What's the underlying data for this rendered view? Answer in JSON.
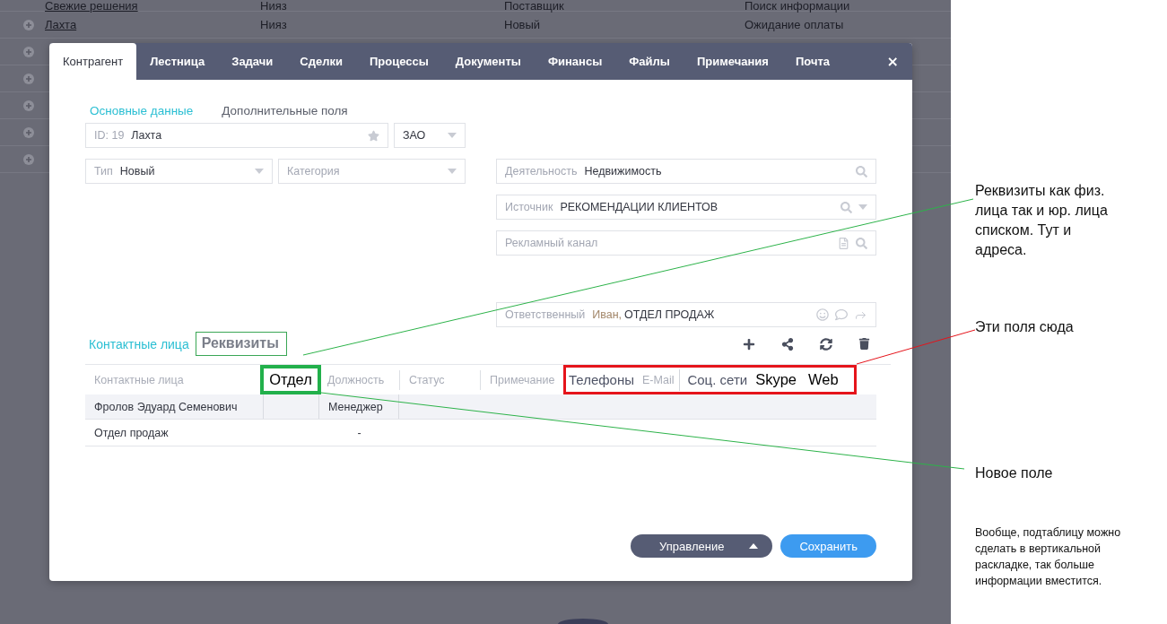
{
  "background_table": {
    "rows": [
      {
        "kind": "visible",
        "cells": [
          "Свежие решения",
          "Нияз",
          "Поставщик",
          "Поиск информации"
        ]
      },
      {
        "kind": "visible",
        "cells": [
          "Лахта",
          "Нияз",
          "Новый",
          "Ожидание оплаты"
        ]
      },
      {
        "kind": "covered"
      },
      {
        "kind": "covered"
      },
      {
        "kind": "covered"
      },
      {
        "kind": "covered"
      },
      {
        "kind": "covered"
      }
    ]
  },
  "dialog": {
    "tabs": [
      {
        "label": "Контрагент",
        "selected": true
      },
      {
        "label": "Лестница",
        "selected": false
      },
      {
        "label": "Задачи",
        "selected": false
      },
      {
        "label": "Сделки",
        "selected": false
      },
      {
        "label": "Процессы",
        "selected": false
      },
      {
        "label": "Документы",
        "selected": false
      },
      {
        "label": "Финансы",
        "selected": false
      },
      {
        "label": "Файлы",
        "selected": false
      },
      {
        "label": "Примечания",
        "selected": false
      },
      {
        "label": "Почта",
        "selected": false
      }
    ],
    "close": "×",
    "subtabs": [
      {
        "label": "Основные данные",
        "selected": true
      },
      {
        "label": "Дополнительные поля",
        "selected": false
      }
    ],
    "left_rows": [
      [
        {
          "kind": "name",
          "label": "ID: 19",
          "value": "Лахта"
        },
        {
          "kind": "select",
          "value": "ЗАО"
        }
      ],
      [
        {
          "kind": "select",
          "label": "Тип",
          "value": "Новый"
        },
        {
          "kind": "select",
          "placeholder": "Категория"
        }
      ]
    ],
    "right_fields": [
      {
        "kind": "search",
        "label": "Деятельность",
        "value": "Недвижимость"
      },
      {
        "kind": "search_select",
        "label": "Источник",
        "value": "РЕКОМЕНДАЦИИ КЛИЕНТОВ"
      },
      {
        "kind": "list_search",
        "placeholder": "Рекламный канал"
      }
    ],
    "responsible": {
      "label": "Ответственный",
      "person": "Иван,",
      "department": "ОТДЕЛ ПРОДАЖ"
    },
    "section_tabs": [
      {
        "label": "Контактные лица",
        "selected": true,
        "marked": false
      },
      {
        "label": "Реквизиты",
        "selected": false,
        "marked": true
      }
    ],
    "contacts_table": {
      "columns": [
        {
          "label": "Контактные лица",
          "kind": "existing",
          "marked": false
        },
        {
          "label": "Отдел",
          "kind": "added",
          "marked": true
        },
        {
          "label": "Должность",
          "kind": "existing",
          "marked": false
        },
        {
          "label": "Статус",
          "kind": "existing",
          "marked": false
        },
        {
          "label": "Примечание",
          "kind": "existing",
          "marked": false
        }
      ],
      "proposed_groups": [
        {
          "columns": [
            {
              "label": "Телефоны",
              "kind": "moved"
            },
            {
              "label": "E-Mail",
              "kind": "existing"
            }
          ]
        },
        {
          "columns": [
            {
              "label": "Соц. сети",
              "kind": "moved"
            },
            {
              "label": "Skype",
              "kind": "added"
            },
            {
              "label": "Web",
              "kind": "added"
            }
          ]
        }
      ],
      "rows": [
        {
          "kind": "contact",
          "selected": true,
          "name": "Фролов Эдуард Семенович",
          "position": "Менеджер"
        },
        {
          "kind": "department",
          "selected": false,
          "name": "Отдел продаж",
          "position": "-"
        }
      ]
    },
    "buttons": [
      {
        "kind": "menu",
        "label": "Управление"
      },
      {
        "kind": "primary",
        "label": "Сохранить"
      }
    ]
  },
  "notes": [
    {
      "kind": "callout",
      "text": "Реквизиты как физ. лица так и юр. лица списком. Тут и адреса."
    },
    {
      "kind": "callout",
      "text": "Эти поля сюда"
    },
    {
      "kind": "callout",
      "text": "Новое поле"
    },
    {
      "kind": "remark",
      "text": "Вообще, подтаблицу можно сделать в вертикальной раскладке, так больше информации вместится."
    }
  ]
}
